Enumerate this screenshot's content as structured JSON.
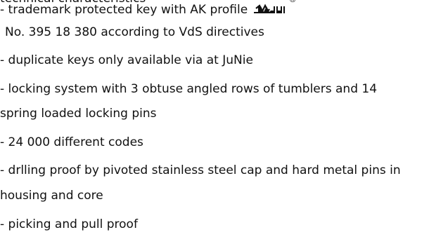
{
  "lines": {
    "heading_partial": "technical characteristics",
    "trademark": "- trademark protected key with AK profile",
    "registered_mark": "®",
    "patent": "No. 395 18 380 according to VdS directives",
    "duplicates": "- duplicate keys only available via at JuNie",
    "locking_1": "- locking system with 3 obtuse angled rows of tumblers and 14",
    "locking_2": "spring loaded locking pins",
    "codes": "- 24 000 different codes",
    "drilling_1": "- drlling proof by pivoted stainless steel cap and hard metal pins in",
    "drilling_2": "housing and core",
    "picking": "- picking and pull proof"
  },
  "icons": {
    "key_profile": "ak-key-profile-icon"
  },
  "colors": {
    "text": "#111111",
    "logo": "#111111"
  }
}
